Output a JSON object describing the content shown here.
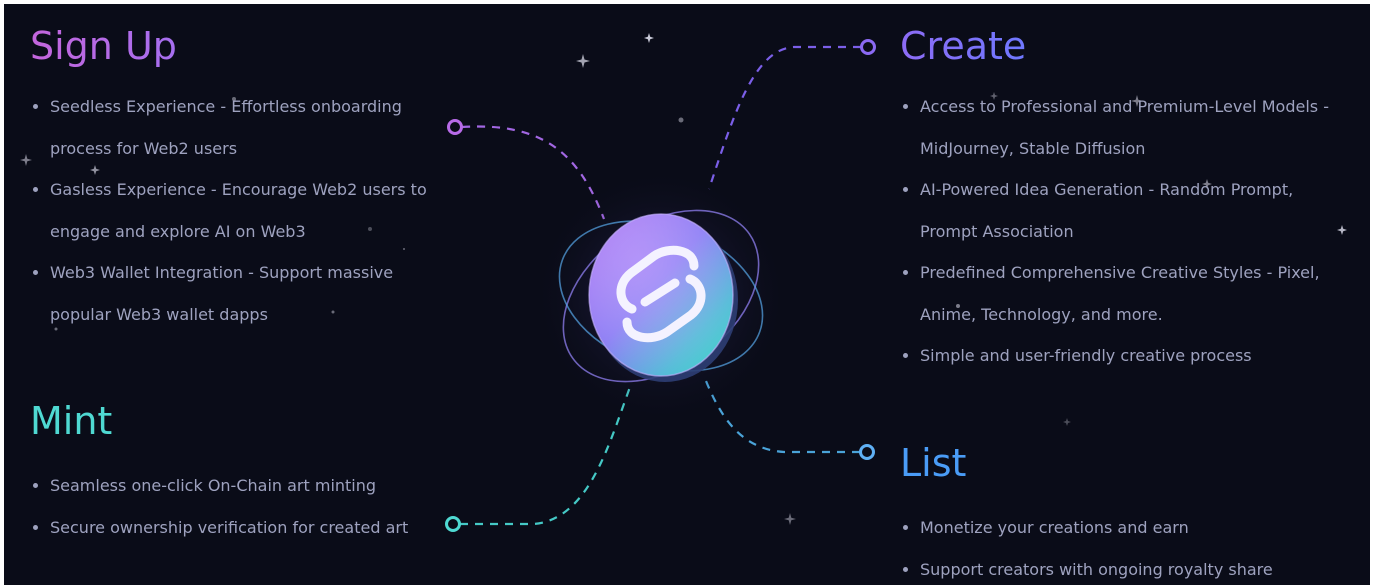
{
  "sections": {
    "signup": {
      "title": "Sign Up",
      "items": [
        "Seedless Experience - Effortless onboarding process for Web2 users",
        "Gasless Experience - Encourage Web2 users to engage and explore AI on Web3",
        "Web3 Wallet Integration - Support massive popular Web3 wallet dapps"
      ]
    },
    "create": {
      "title": "Create",
      "items": [
        "Access to Professional and Premium-Level Models - MidJourney, Stable Diffusion",
        "AI-Powered Idea Generation - Random Prompt, Prompt Association",
        "Predefined Comprehensive Creative Styles - Pixel, Anime, Technology, and more.",
        "Simple and user-friendly creative process"
      ]
    },
    "mint": {
      "title": "Mint",
      "items": [
        "Seamless one-click On-Chain art minting",
        "Secure ownership verification for created art"
      ]
    },
    "list": {
      "title": "List",
      "items": [
        "Monetize your creations and earn",
        "Support creators with ongoing royalty share"
      ]
    }
  },
  "colors": {
    "background": "#0a0c18",
    "signup": "#b568e6",
    "create": "#7f6ef8",
    "mint": "#4fd9d2",
    "list": "#4a9cf6",
    "body_text": "#9ea2bf"
  },
  "icons": {
    "center_logo": "app-logo-icon",
    "connector_dot": "ring-dot-icon",
    "sparkle": "sparkle-icon"
  }
}
